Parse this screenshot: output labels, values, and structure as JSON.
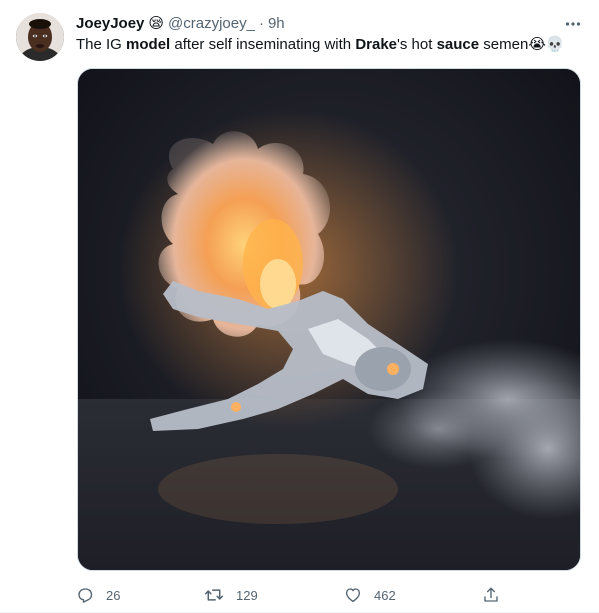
{
  "tweet": {
    "display_name": "JoeyJoey",
    "name_emoji": "😪",
    "handle": "@crazyjoey_",
    "separator": "·",
    "time": "9h",
    "text_parts": [
      "The IG ",
      "model",
      " after self inseminating with ",
      "Drake",
      "'s hot ",
      "sauce",
      " semen",
      "😭💀"
    ]
  },
  "actions": {
    "reply_count": "26",
    "retweet_count": "129",
    "like_count": "462"
  },
  "icons": {
    "more": "more-horizontal-icon",
    "reply": "reply-icon",
    "retweet": "retweet-icon",
    "like": "heart-icon",
    "share": "share-icon"
  },
  "colors": {
    "text": "#0f1419",
    "muted": "#536471",
    "border": "#cfd9de"
  }
}
